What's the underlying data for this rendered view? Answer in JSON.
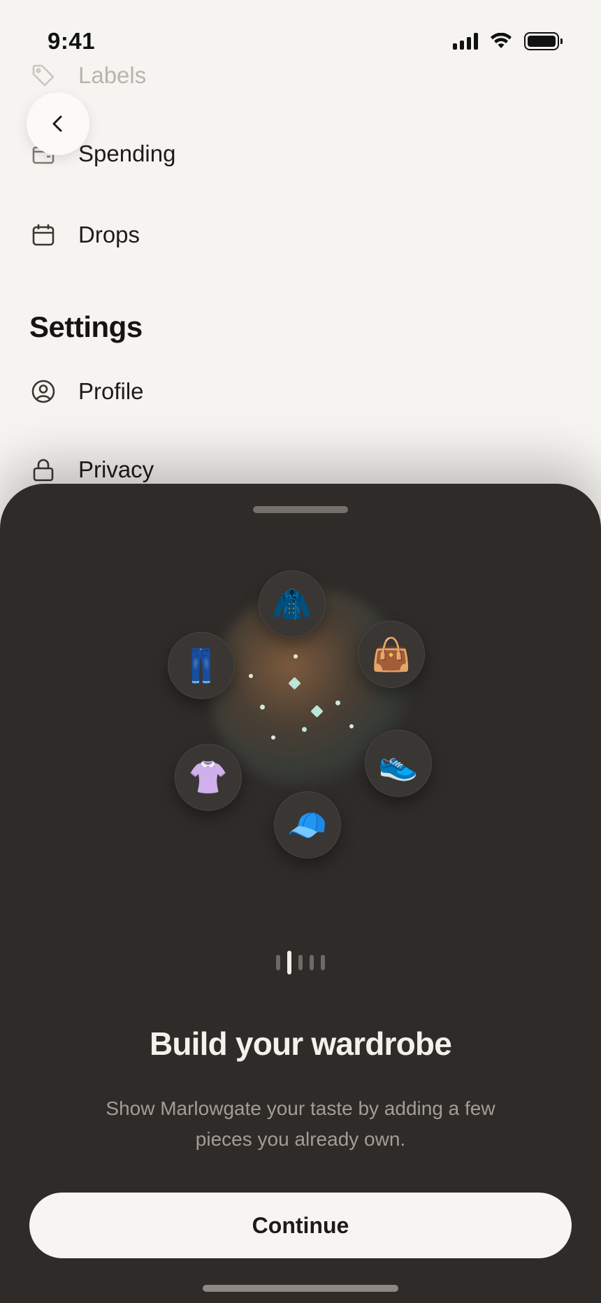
{
  "status_bar": {
    "time": "9:41"
  },
  "menu": {
    "items": [
      {
        "label": "Labels",
        "icon": "tag-icon"
      },
      {
        "label": "Spending",
        "icon": "wallet-icon"
      },
      {
        "label": "Drops",
        "icon": "calendar-icon"
      }
    ],
    "settings_title": "Settings",
    "settings_items": [
      {
        "label": "Profile",
        "icon": "user-circle-icon"
      },
      {
        "label": "Privacy",
        "icon": "lock-icon"
      }
    ]
  },
  "sheet": {
    "orbit_items": [
      {
        "emoji": "🧥",
        "name": "coat"
      },
      {
        "emoji": "👜",
        "name": "handbag"
      },
      {
        "emoji": "👟",
        "name": "sneaker"
      },
      {
        "emoji": "🧢",
        "name": "cap"
      },
      {
        "emoji": "👚",
        "name": "blouse"
      },
      {
        "emoji": "👖",
        "name": "jeans"
      }
    ],
    "pager": {
      "total": 5,
      "current": 2
    },
    "title": "Build your wardrobe",
    "body": "Show Marlowgate your taste by adding a few pieces you already own.",
    "continue_label": "Continue"
  },
  "colors": {
    "background": "#f6f4f0",
    "sheet": "#2e2b28",
    "button": "#f7f5f1",
    "glow_warm": "#be8250",
    "sparkle": "#b9e6d8"
  }
}
